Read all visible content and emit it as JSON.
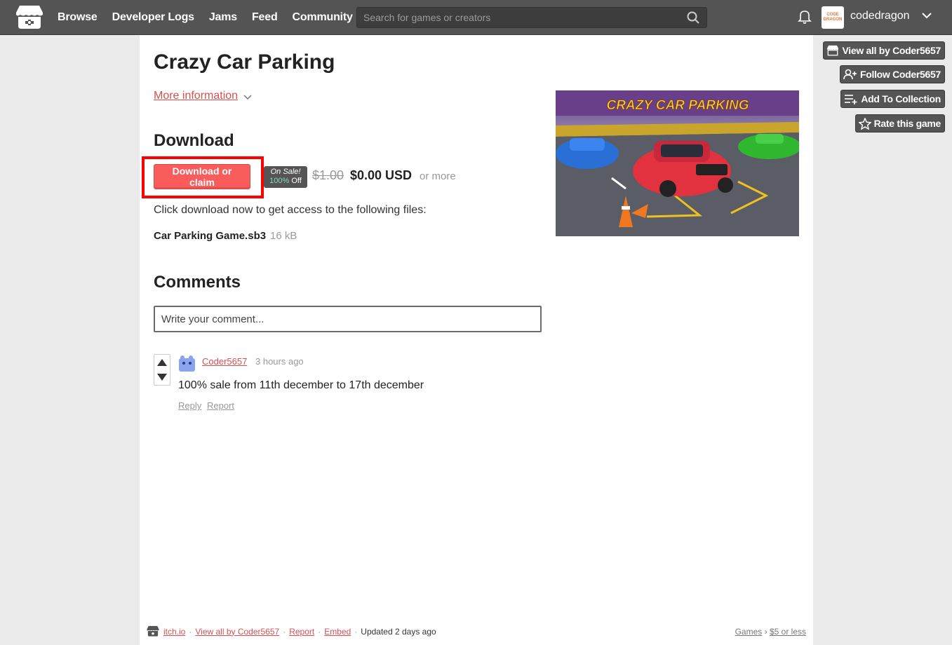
{
  "header": {
    "nav": [
      "Browse",
      "Developer Logs",
      "Jams",
      "Feed",
      "Community"
    ],
    "search_placeholder": "Search for games or creators",
    "username": "codedragon",
    "avatar_text": "CODE DRAGON"
  },
  "game": {
    "title": "Crazy Car Parking",
    "more_info": "More information",
    "cover_title": "CRAZY CAR PARKING"
  },
  "download": {
    "heading": "Download",
    "button_label": "Download or claim",
    "sale_label": "On Sale!",
    "sale_percent": "100%",
    "sale_off": "Off",
    "old_price": "$1.00",
    "new_price": "$0.00 USD",
    "or_more": "or more",
    "description": "Click download now to get access to the following files:",
    "file_name": "Car Parking Game.sb3",
    "file_size": "16 kB"
  },
  "comments": {
    "heading": "Comments",
    "input_placeholder": "Write your comment...",
    "items": [
      {
        "author": "Coder5657",
        "time": "3 hours ago",
        "body": "100% sale from 11th december to 17th december",
        "reply": "Reply",
        "report": "Report"
      }
    ]
  },
  "footer": {
    "site": "itch.io",
    "view_all": "View all by Coder5657",
    "report": "Report",
    "embed": "Embed",
    "updated": "Updated 2 days ago",
    "crumb_games": "Games",
    "crumb_sep": "›",
    "crumb_price": "$5 or less"
  },
  "sidebar": {
    "view_all": "View all by Coder5657",
    "follow": "Follow Coder5657",
    "add_collection": "Add To Collection",
    "rate": "Rate this game"
  },
  "colors": {
    "accent": "#fa5c5c",
    "link": "#da4e4e",
    "topbar": "#545454",
    "sale_green": "#7fdcbc"
  }
}
